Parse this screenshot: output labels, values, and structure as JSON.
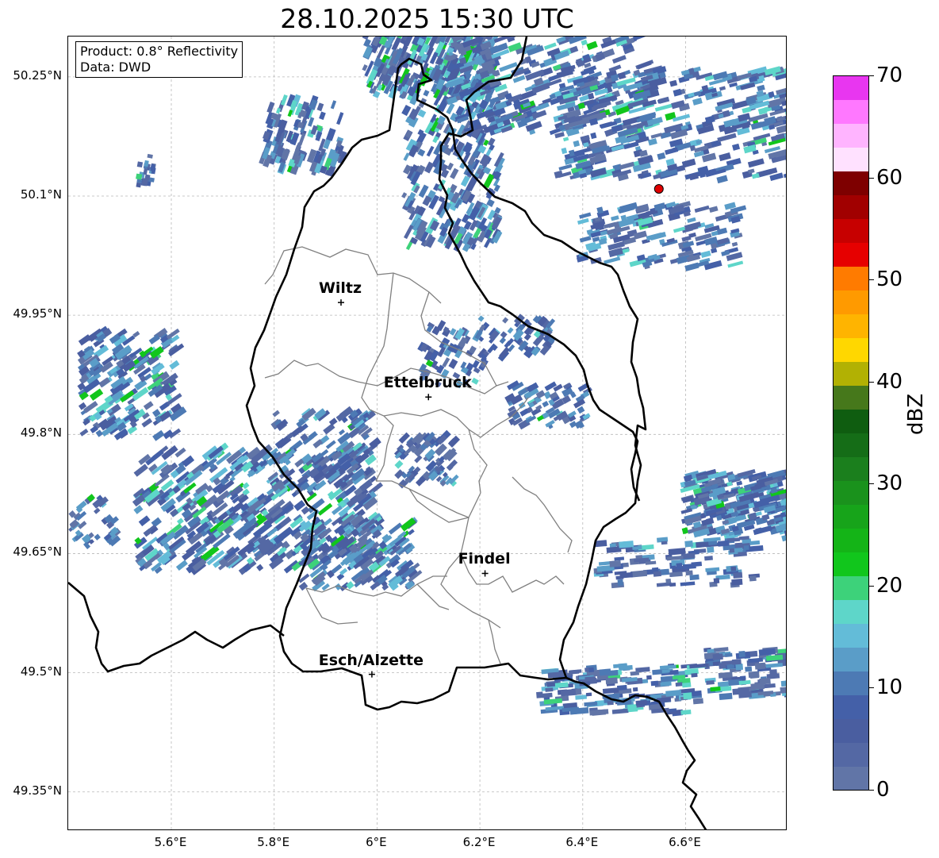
{
  "title": "28.10.2025 15:30 UTC",
  "info": {
    "product": "Product: 0.8° Reflectivity",
    "data": "Data: DWD"
  },
  "y_axis": {
    "ticks": [
      "50.25°N",
      "50.1°N",
      "49.95°N",
      "49.8°N",
      "49.65°N",
      "49.5°N",
      "49.35°N"
    ]
  },
  "x_axis": {
    "ticks": [
      "5.6°E",
      "5.8°E",
      "6°E",
      "6.2°E",
      "6.4°E",
      "6.6°E"
    ]
  },
  "colorbar": {
    "label": "dBZ",
    "ticks": [
      "0",
      "10",
      "20",
      "30",
      "40",
      "50",
      "60",
      "70"
    ],
    "min": 0,
    "max": 70,
    "step": 2.5,
    "colors": [
      "#6175a7",
      "#5468a4",
      "#4a5ea0",
      "#4460a8",
      "#4d7ab4",
      "#5a9dc8",
      "#63bcd8",
      "#5ed6c9",
      "#3dd27a",
      "#11c61c",
      "#14b417",
      "#17a41a",
      "#1a921c",
      "#1b7f1d",
      "#156d17",
      "#0f5d10",
      "#46781b",
      "#b2b103",
      "#ffd700",
      "#ffb400",
      "#ff9a00",
      "#ff7b00",
      "#e60000",
      "#c70000",
      "#a10000",
      "#7e0000",
      "#ffe1ff",
      "#ffb4ff",
      "#ff78ff",
      "#e836f0"
    ]
  },
  "cities": [
    {
      "name": "Wiltz",
      "lon": 5.93,
      "lat": 49.966
    },
    {
      "name": "Ettelbruck",
      "lon": 6.1,
      "lat": 49.847
    },
    {
      "name": "Findel",
      "lon": 6.21,
      "lat": 49.625
    },
    {
      "name": "Esch/Alzette",
      "lon": 5.99,
      "lat": 49.498
    }
  ],
  "radar_site": {
    "lon": 6.548,
    "lat": 50.109,
    "color": "#e00000"
  },
  "map_extent": {
    "lon_min": 5.4,
    "lon_max": 6.8,
    "lat_min": 49.3,
    "lat_max": 50.3
  },
  "colors": {
    "country_border": "#000000",
    "district_border": "#808080",
    "grid": "#b0b0b0"
  }
}
